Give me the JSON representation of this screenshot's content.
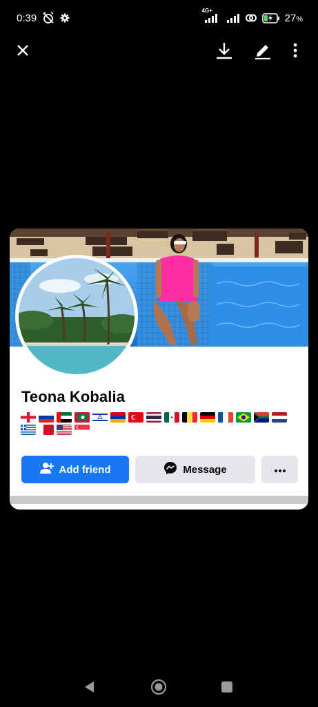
{
  "status_bar": {
    "time": "0:39",
    "network_label": "4G+",
    "battery": "27",
    "battery_unit": "%"
  },
  "toolbar": {
    "close_icon": "close-icon",
    "download_icon": "download-icon",
    "edit_icon": "edit-icon",
    "more_icon": "more-vertical-icon"
  },
  "profile": {
    "name": "Teona Kobalia",
    "flags": [
      "Georgia",
      "Russia",
      "UAE",
      "Maldives",
      "Israel",
      "Armenia",
      "Turkey",
      "Thailand",
      "Mexico",
      "Belgium",
      "Germany",
      "France",
      "Brazil",
      "South Africa",
      "Netherlands",
      "Greece",
      "Bahrain",
      "USA",
      "Singapore"
    ]
  },
  "actions": {
    "add_friend": "Add friend",
    "message": "Message",
    "more": "more-horizontal-icon"
  },
  "colors": {
    "primary": "#1877f2",
    "secondary_button": "#e4e6eb",
    "background": "#000000"
  }
}
